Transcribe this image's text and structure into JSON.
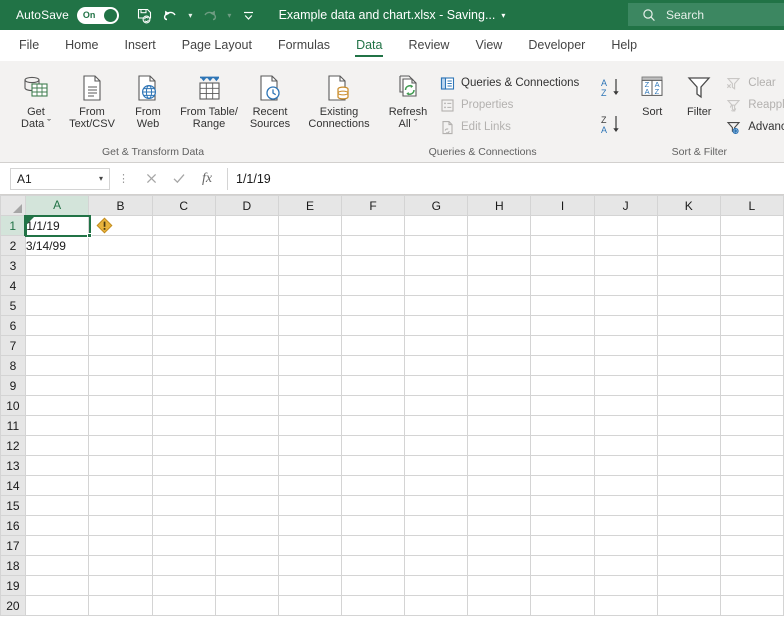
{
  "titlebar": {
    "autosave_label": "AutoSave",
    "autosave_state": "On",
    "document_title": "Example data and chart.xlsx  -  Saving...",
    "title_caret": "▾",
    "save_icon": "save-icon",
    "undo_icon": "undo-icon",
    "redo_icon": "redo-icon",
    "customize_icon": "customize-quick-access-icon",
    "accent_color": "#217346"
  },
  "search": {
    "placeholder": "Search",
    "icon": "search-icon"
  },
  "tabs": [
    {
      "label": "File",
      "active": false
    },
    {
      "label": "Home",
      "active": false
    },
    {
      "label": "Insert",
      "active": false
    },
    {
      "label": "Page Layout",
      "active": false
    },
    {
      "label": "Formulas",
      "active": false
    },
    {
      "label": "Data",
      "active": true
    },
    {
      "label": "Review",
      "active": false
    },
    {
      "label": "View",
      "active": false
    },
    {
      "label": "Developer",
      "active": false
    },
    {
      "label": "Help",
      "active": false
    }
  ],
  "ribbon": {
    "groups": [
      {
        "name": "Get & Transform Data",
        "label": "Get & Transform Data",
        "buttons": [
          {
            "label": "Get\nData ˇ",
            "icon": "get-data-icon"
          },
          {
            "label": "From\nText/CSV",
            "icon": "from-text-csv-icon"
          },
          {
            "label": "From\nWeb",
            "icon": "from-web-icon"
          },
          {
            "label": "From Table/\nRange",
            "icon": "from-table-range-icon"
          },
          {
            "label": "Recent\nSources",
            "icon": "recent-sources-icon"
          },
          {
            "label": "Existing\nConnections",
            "icon": "existing-connections-icon"
          }
        ]
      },
      {
        "name": "Queries & Connections",
        "label": "Queries & Connections",
        "big": {
          "label": "Refresh\nAll ˇ",
          "icon": "refresh-all-icon"
        },
        "small": [
          {
            "label": "Queries & Connections",
            "icon": "queries-connections-icon",
            "disabled": false
          },
          {
            "label": "Properties",
            "icon": "properties-icon",
            "disabled": true
          },
          {
            "label": "Edit Links",
            "icon": "edit-links-icon",
            "disabled": true
          }
        ]
      },
      {
        "name": "Sort & Filter",
        "label": "Sort & Filter",
        "mini": [
          {
            "label": "Sort A to Z",
            "icon": "sort-ascending-icon"
          },
          {
            "label": "Sort Z to A",
            "icon": "sort-descending-icon"
          }
        ],
        "big": [
          {
            "label": "Sort",
            "icon": "sort-icon"
          },
          {
            "label": "Filter",
            "icon": "filter-icon"
          }
        ],
        "small": [
          {
            "label": "Clear",
            "icon": "clear-filter-icon",
            "disabled": true
          },
          {
            "label": "Reapply",
            "icon": "reapply-filter-icon",
            "disabled": true
          },
          {
            "label": "Advanced",
            "icon": "advanced-filter-icon",
            "disabled": false
          }
        ]
      }
    ]
  },
  "formulabar": {
    "namebox_value": "A1",
    "namebox_caret": "▾",
    "cancel_icon": "cancel-icon",
    "enter_icon": "confirm-checkmark-icon",
    "function_icon": "insert-function-icon",
    "function_label": "fx",
    "formula_value": "1/1/19"
  },
  "grid": {
    "columns": [
      "A",
      "B",
      "C",
      "D",
      "E",
      "F",
      "G",
      "H",
      "I",
      "J",
      "K",
      "L"
    ],
    "selected_column": "A",
    "rows": [
      "1",
      "2",
      "3",
      "4",
      "5",
      "6",
      "7",
      "8",
      "9",
      "10",
      "11",
      "12",
      "13",
      "14",
      "15",
      "16",
      "17",
      "18",
      "19",
      "20"
    ],
    "selected_row": "1",
    "cells": {
      "A1": "1/1/19",
      "A2": "3/14/99"
    },
    "active_cell": "A1",
    "error_indicator": {
      "cell": "A1",
      "icon": "error-warning-icon",
      "glyph": "!",
      "color": "#e8b33c"
    }
  }
}
